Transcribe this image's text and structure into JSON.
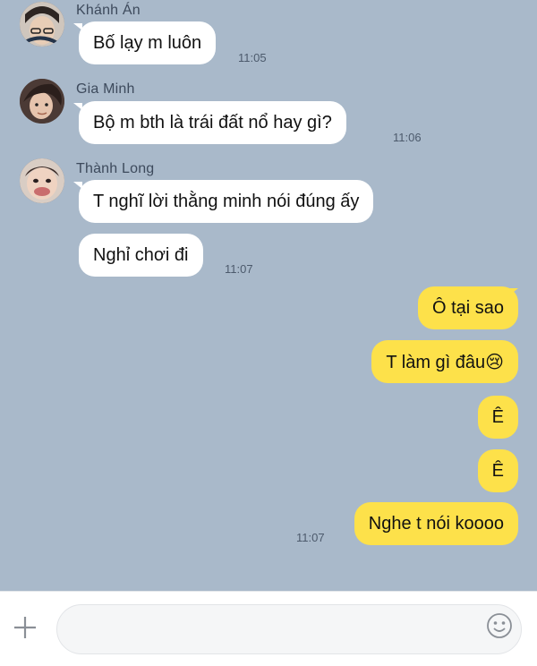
{
  "messages_in": [
    {
      "sender": "Khánh Án",
      "bubbles": [
        "Bố lạy m luôn"
      ],
      "time": "11:05"
    },
    {
      "sender": "Gia Minh",
      "bubbles": [
        "Bộ m bth là trái đất nổ hay gì?"
      ],
      "time": "11:06"
    },
    {
      "sender": "Thành Long",
      "bubbles": [
        "T nghĩ lời thằng minh nói đúng ấy",
        "Nghỉ chơi đi"
      ],
      "time": "11:07"
    }
  ],
  "messages_out": {
    "bubbles": [
      "Ô tại sao",
      "T làm gì đâu😢",
      "Ê",
      "Ê",
      "Nghe t nói koooo"
    ],
    "time": "11:07"
  },
  "input_bar": {
    "placeholder": "",
    "icons": [
      "plus-icon",
      "emoji-icon"
    ]
  },
  "colors": {
    "background": "#a9b9ca",
    "incoming_bubble": "#ffffff",
    "outgoing_bubble": "#fde14a"
  }
}
